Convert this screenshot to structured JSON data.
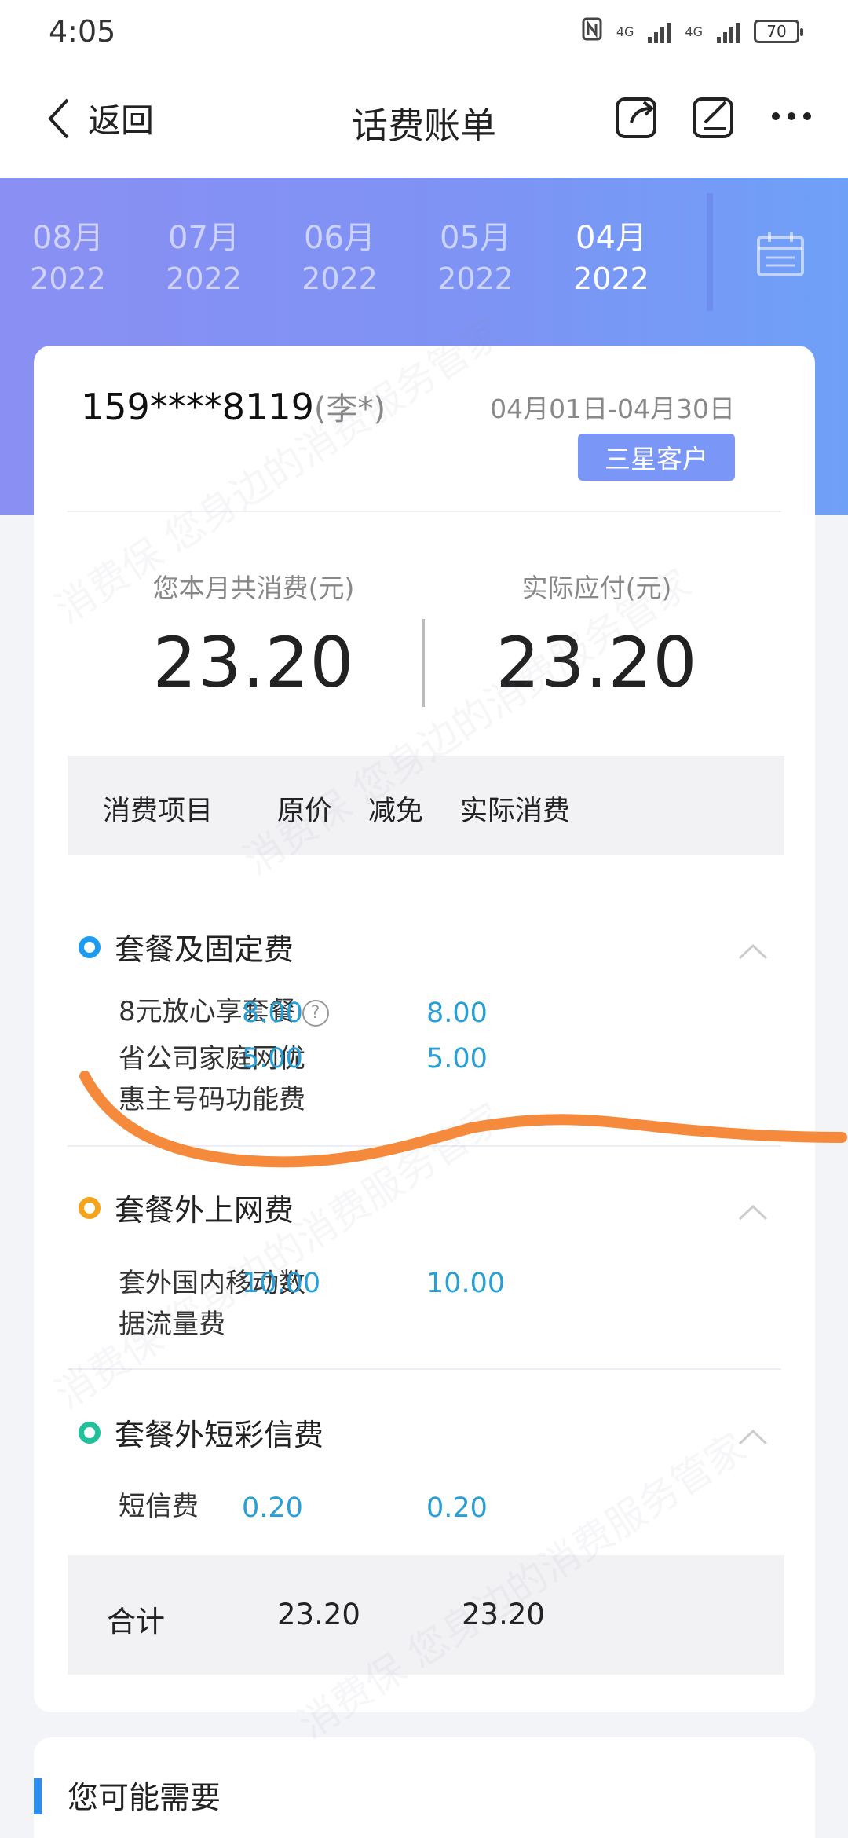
{
  "status_bar": {
    "time": "4:05",
    "network1": "4G",
    "network2": "4G",
    "battery": "70"
  },
  "nav": {
    "back_label": "返回",
    "title": "话费账单"
  },
  "months": [
    {
      "month": "08月",
      "year": "2022"
    },
    {
      "month": "07月",
      "year": "2022"
    },
    {
      "month": "06月",
      "year": "2022"
    },
    {
      "month": "05月",
      "year": "2022"
    },
    {
      "month": "04月",
      "year": "2022",
      "active": true
    }
  ],
  "account": {
    "phone": "159****8119",
    "name": "(李*)",
    "period": "04月01日-04月30日",
    "level": "三星客户"
  },
  "summary": {
    "total_label": "您本月共消费(元)",
    "total_value": "23.20",
    "payable_label": "实际应付(元)",
    "payable_value": "23.20"
  },
  "table": {
    "headers": [
      "消费项目",
      "原价",
      "减免",
      "实际消费"
    ],
    "sections": [
      {
        "title": "套餐及固定费",
        "items": [
          {
            "name": "8元放心享套餐",
            "original": "8.00",
            "actual": "8.00"
          },
          {
            "name_line1": "省公司家庭网优",
            "name_line2": "惠主号码功能费",
            "original": "5.00",
            "actual": "5.00"
          }
        ]
      },
      {
        "title": "套餐外上网费",
        "items": [
          {
            "name_line1": "套外国内移动数",
            "name_line2": "据流量费",
            "original": "10.00",
            "actual": "10.00"
          }
        ]
      },
      {
        "title": "套餐外短彩信费",
        "items": [
          {
            "name": "短信费",
            "original": "0.20",
            "actual": "0.20"
          }
        ]
      }
    ],
    "total": {
      "label": "合计",
      "original": "23.20",
      "actual": "23.20"
    }
  },
  "recommend": {
    "title": "您可能需要"
  },
  "watermark": {
    "text1": "消费保 您身边的消费服务管家"
  },
  "colors": {
    "accent_blue": "#2a9fd6",
    "badge": "#7a96f6",
    "dot_blue": "#1d9bf0",
    "dot_orange": "#f4a31a",
    "dot_green": "#1fc29a",
    "scribble": "#f58a3c"
  }
}
